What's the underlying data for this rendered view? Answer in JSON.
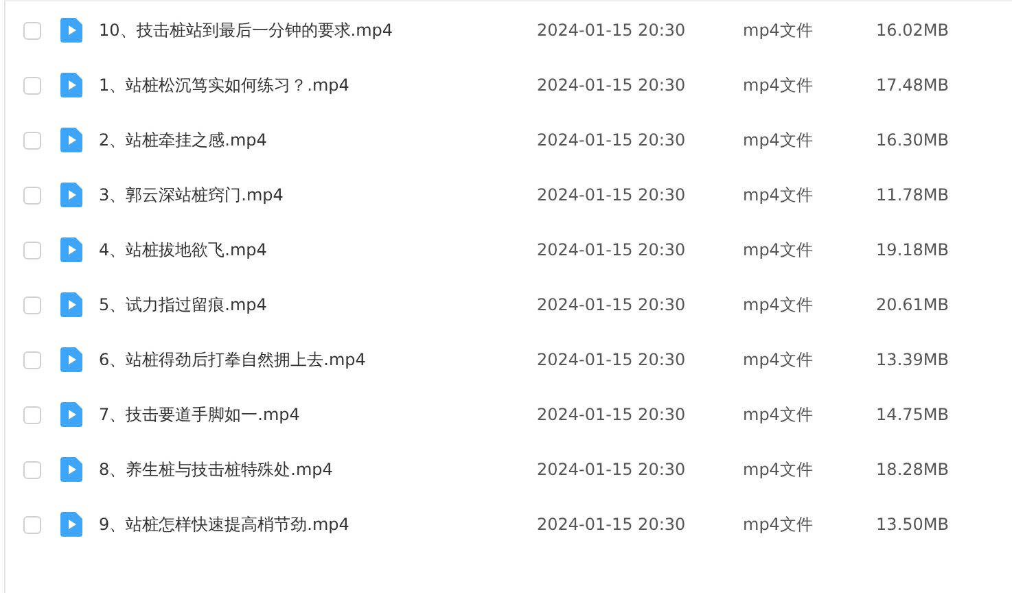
{
  "files": [
    {
      "name": "10、技击桩站到最后一分钟的要求.mp4",
      "date": "2024-01-15 20:30",
      "type": "mp4文件",
      "size": "16.02MB",
      "checked": false
    },
    {
      "name": "1、站桩松沉笃实如何练习？.mp4",
      "date": "2024-01-15 20:30",
      "type": "mp4文件",
      "size": "17.48MB",
      "checked": false
    },
    {
      "name": "2、站桩牵挂之感.mp4",
      "date": "2024-01-15 20:30",
      "type": "mp4文件",
      "size": "16.30MB",
      "checked": false
    },
    {
      "name": "3、郭云深站桩窍门.mp4",
      "date": "2024-01-15 20:30",
      "type": "mp4文件",
      "size": "11.78MB",
      "checked": false
    },
    {
      "name": "4、站桩拔地欲飞.mp4",
      "date": "2024-01-15 20:30",
      "type": "mp4文件",
      "size": "19.18MB",
      "checked": false
    },
    {
      "name": "5、试力指过留痕.mp4",
      "date": "2024-01-15 20:30",
      "type": "mp4文件",
      "size": "20.61MB",
      "checked": false
    },
    {
      "name": "6、站桩得劲后打拳自然拥上去.mp4",
      "date": "2024-01-15 20:30",
      "type": "mp4文件",
      "size": "13.39MB",
      "checked": false
    },
    {
      "name": "7、技击要道手脚如一.mp4",
      "date": "2024-01-15 20:30",
      "type": "mp4文件",
      "size": "14.75MB",
      "checked": false
    },
    {
      "name": "8、养生桩与技击桩特殊处.mp4",
      "date": "2024-01-15 20:30",
      "type": "mp4文件",
      "size": "18.28MB",
      "checked": false
    },
    {
      "name": "9、站桩怎样快速提高梢节劲.mp4",
      "date": "2024-01-15 20:30",
      "type": "mp4文件",
      "size": "13.50MB",
      "checked": false
    }
  ]
}
